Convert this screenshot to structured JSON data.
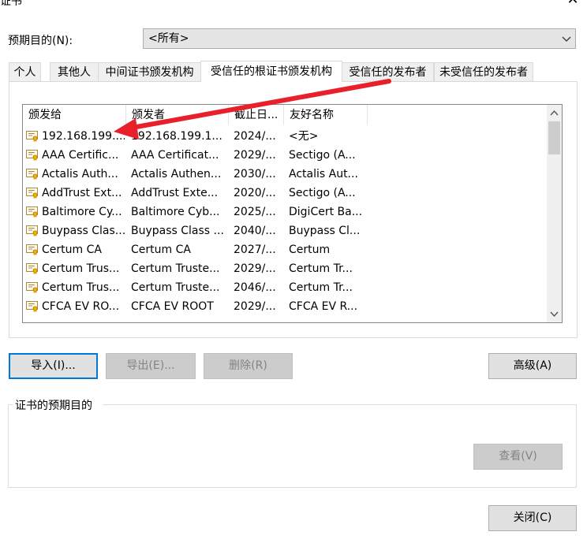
{
  "window": {
    "title": "证书"
  },
  "purpose": {
    "label": "预期目的(N):",
    "selected": "<所有>"
  },
  "tabs": [
    {
      "label": "个人"
    },
    {
      "label": "其他人"
    },
    {
      "label": "中间证书颁发机构"
    },
    {
      "label": "受信任的根证书颁发机构"
    },
    {
      "label": "受信任的发布者"
    },
    {
      "label": "未受信任的发布者"
    }
  ],
  "active_tab": "受信任的根证书颁发机构",
  "table": {
    "columns": [
      "颁发给",
      "颁发者",
      "截止日...",
      "友好名称"
    ],
    "rows": [
      [
        "192.168.199....",
        "192.168.199.1...",
        "2024/...",
        "<无>"
      ],
      [
        "AAA Certific...",
        "AAA Certificat...",
        "2029/...",
        "Sectigo (A..."
      ],
      [
        "Actalis Auth...",
        "Actalis Authen...",
        "2030/...",
        "Actalis Aut..."
      ],
      [
        "AddTrust Ext...",
        "AddTrust Exte...",
        "2020/...",
        "Sectigo (A..."
      ],
      [
        "Baltimore Cy...",
        "Baltimore Cyb...",
        "2025/...",
        "DigiCert Ba..."
      ],
      [
        "Buypass Clas...",
        "Buypass Class ...",
        "2040/...",
        "Buypass Cl..."
      ],
      [
        "Certum CA",
        "Certum CA",
        "2027/...",
        "Certum"
      ],
      [
        "Certum Trus...",
        "Certum Truste...",
        "2029/...",
        "Certum Tr..."
      ],
      [
        "Certum Trus...",
        "Certum Truste...",
        "2046/...",
        "Certum Tr..."
      ],
      [
        "CFCA EV RO...",
        "CFCA EV ROOT",
        "2029/...",
        "CFCA EV R..."
      ]
    ]
  },
  "buttons": {
    "import": "导入(I)...",
    "export": "导出(E)...",
    "remove": "删除(R)",
    "advanced": "高级(A)",
    "view": "查看(V)",
    "close": "关闭(C)"
  },
  "purposes_group": {
    "label": "证书的预期目的"
  },
  "annotation": {
    "color": "#e8202a"
  }
}
